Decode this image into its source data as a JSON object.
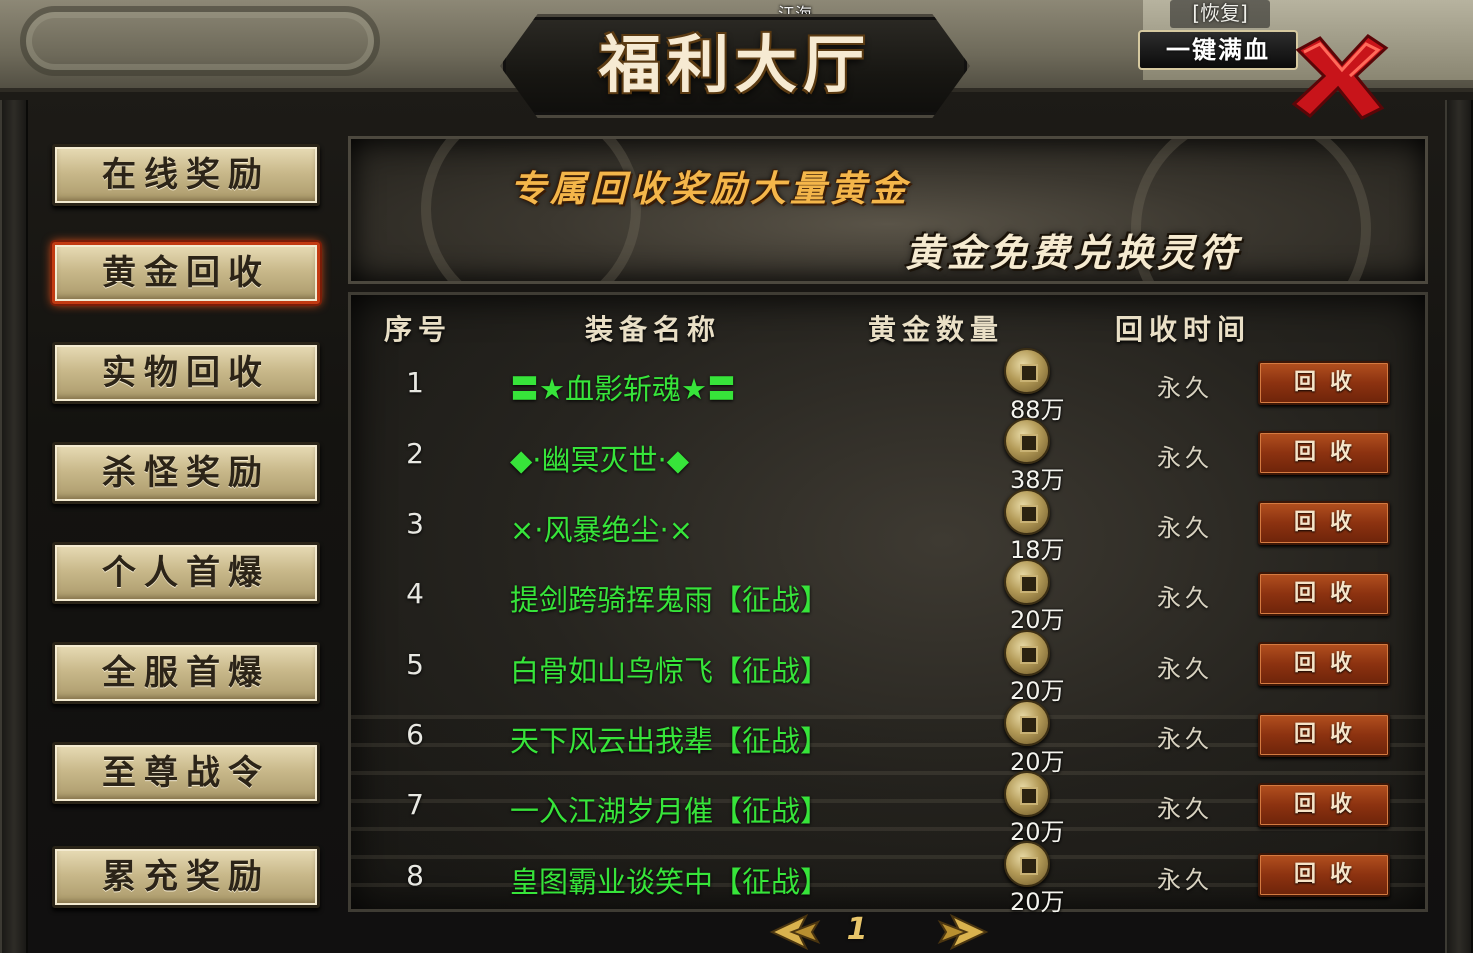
{
  "server_name": "江海",
  "hud_tag": "[恢复]",
  "heal_button": "一键满血",
  "title": "福利大厅",
  "menu": [
    {
      "label": "在线奖励",
      "active": false
    },
    {
      "label": "黄金回收",
      "active": true
    },
    {
      "label": "实物回收",
      "active": false
    },
    {
      "label": "杀怪奖励",
      "active": false
    },
    {
      "label": "个人首爆",
      "active": false
    },
    {
      "label": "全服首爆",
      "active": false
    },
    {
      "label": "至尊战令",
      "active": false
    },
    {
      "label": "累充奖励",
      "active": false
    }
  ],
  "banner": {
    "line1": "专属回收奖励大量黄金",
    "line2": "黄金免费兑换灵符"
  },
  "table": {
    "headers": [
      "序号",
      "装备名称",
      "黄金数量",
      "回收时间"
    ],
    "rows": [
      {
        "index": "1",
        "name": "〓★血影斩魂★〓",
        "gold": "88万",
        "time": "永久",
        "action": "回收"
      },
      {
        "index": "2",
        "name": "◆·幽冥灭世·◆",
        "gold": "38万",
        "time": "永久",
        "action": "回收"
      },
      {
        "index": "3",
        "name": "×·风暴绝尘·×",
        "gold": "18万",
        "time": "永久",
        "action": "回收"
      },
      {
        "index": "4",
        "name": "提剑跨骑挥鬼雨【征战】",
        "gold": "20万",
        "time": "永久",
        "action": "回收"
      },
      {
        "index": "5",
        "name": "白骨如山鸟惊飞【征战】",
        "gold": "20万",
        "time": "永久",
        "action": "回收"
      },
      {
        "index": "6",
        "name": "天下风云出我辈【征战】",
        "gold": "20万",
        "time": "永久",
        "action": "回收"
      },
      {
        "index": "7",
        "name": "一入江湖岁月催【征战】",
        "gold": "20万",
        "time": "永久",
        "action": "回收"
      },
      {
        "index": "8",
        "name": "皇图霸业谈笑中【征战】",
        "gold": "20万",
        "time": "永久",
        "action": "回收"
      }
    ]
  },
  "pager": {
    "current_page": "1"
  },
  "colors": {
    "item_name": "#37e43a",
    "banner_gold": "#f4b64a",
    "active_menu_border": "#c23a12",
    "recycle_button": "#8c3210"
  },
  "icons": {
    "close": "close-x-icon",
    "coin": "coin-icon",
    "prev": "arrow-left-icon",
    "next": "arrow-right-icon"
  }
}
